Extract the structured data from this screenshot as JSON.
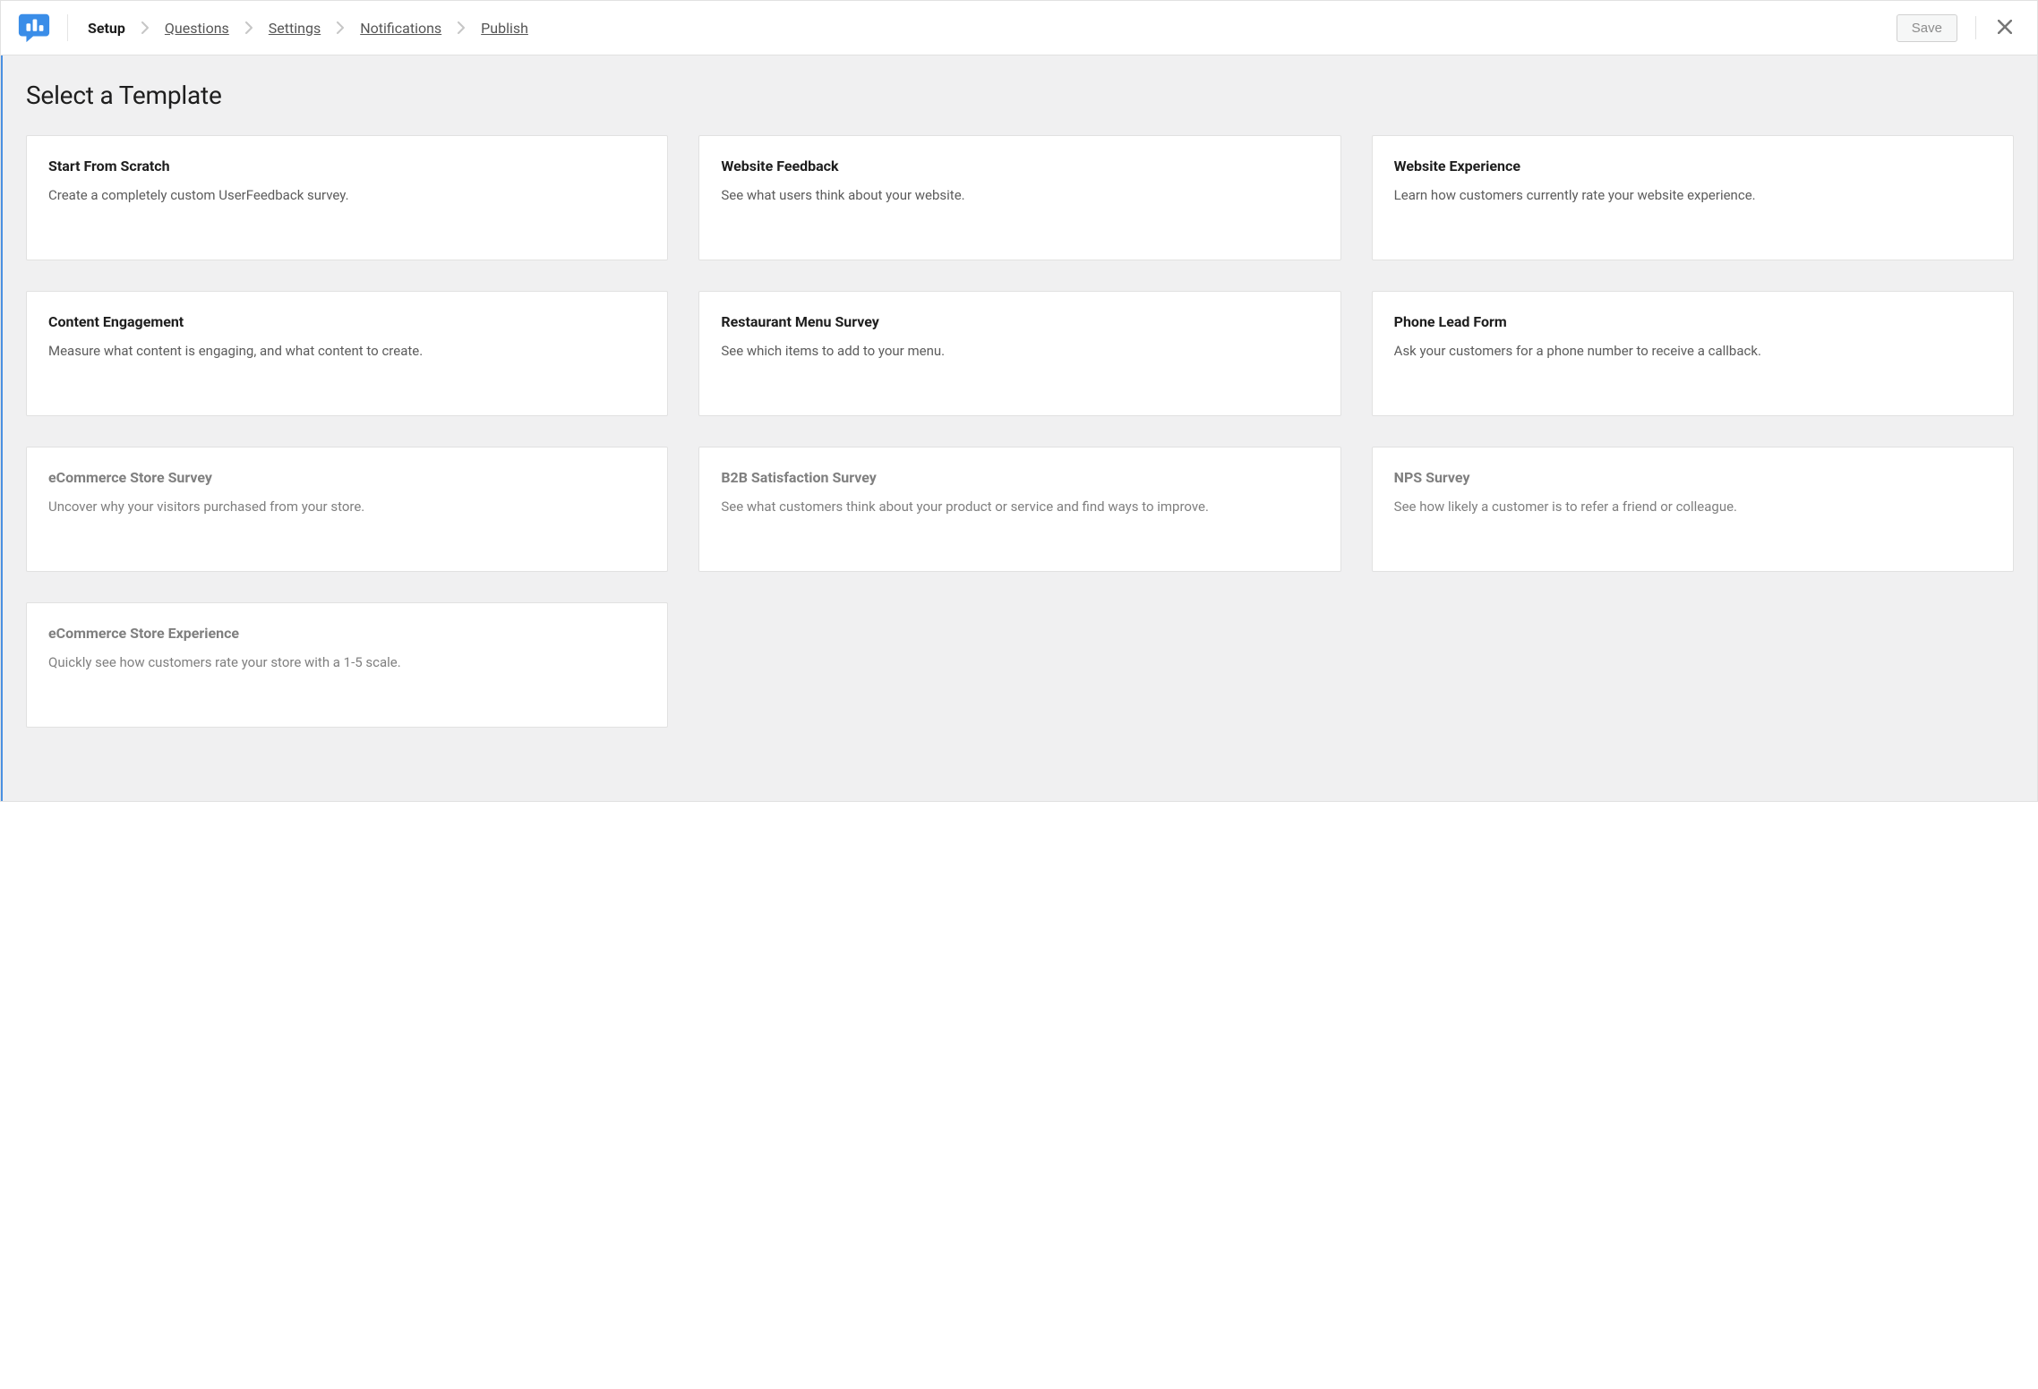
{
  "header": {
    "steps": [
      {
        "label": "Setup",
        "active": true
      },
      {
        "label": "Questions",
        "active": false
      },
      {
        "label": "Settings",
        "active": false
      },
      {
        "label": "Notifications",
        "active": false
      },
      {
        "label": "Publish",
        "active": false
      }
    ],
    "save_label": "Save"
  },
  "page": {
    "title": "Select a Template"
  },
  "templates": [
    {
      "title": "Start From Scratch",
      "desc": "Create a completely custom UserFeedback survey.",
      "disabled": false
    },
    {
      "title": "Website Feedback",
      "desc": "See what users think about your website.",
      "disabled": false
    },
    {
      "title": "Website Experience",
      "desc": "Learn how customers currently rate your website experience.",
      "disabled": false
    },
    {
      "title": "Content Engagement",
      "desc": "Measure what content is engaging, and what content to create.",
      "disabled": false
    },
    {
      "title": "Restaurant Menu Survey",
      "desc": "See which items to add to your menu.",
      "disabled": false
    },
    {
      "title": "Phone Lead Form",
      "desc": "Ask your customers for a phone number to receive a callback.",
      "disabled": false
    },
    {
      "title": "eCommerce Store Survey",
      "desc": "Uncover why your visitors purchased from your store.",
      "disabled": true
    },
    {
      "title": "B2B Satisfaction Survey",
      "desc": "See what customers think about your product or service and find ways to improve.",
      "disabled": true
    },
    {
      "title": "NPS Survey",
      "desc": "See how likely a customer is to refer a friend or colleague.",
      "disabled": true
    },
    {
      "title": "eCommerce Store Experience",
      "desc": "Quickly see how customers rate your store with a 1-5 scale.",
      "disabled": true
    }
  ]
}
